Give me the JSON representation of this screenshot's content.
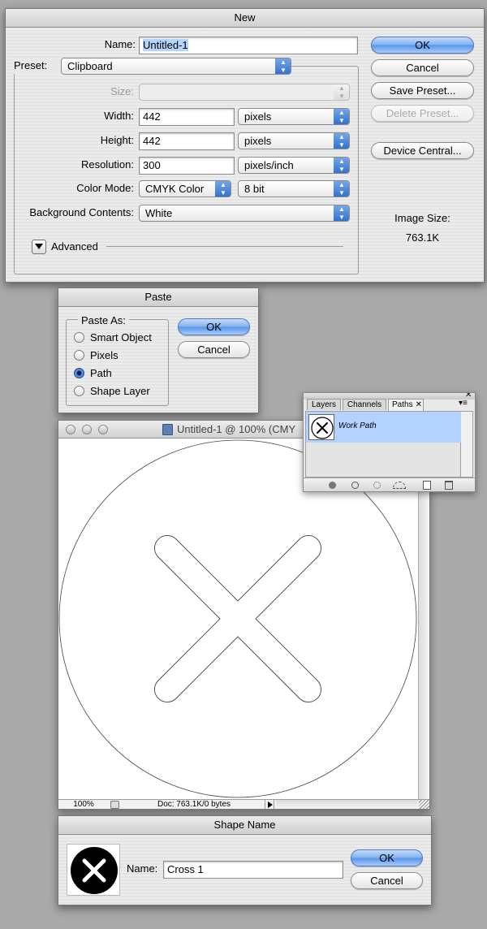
{
  "new_dialog": {
    "title": "New",
    "name_label": "Name:",
    "name_value": "Untitled-1",
    "preset_label": "Preset:",
    "preset_value": "Clipboard",
    "size_label": "Size:",
    "width_label": "Width:",
    "width_value": "442",
    "width_unit": "pixels",
    "height_label": "Height:",
    "height_value": "442",
    "height_unit": "pixels",
    "resolution_label": "Resolution:",
    "resolution_value": "300",
    "resolution_unit": "pixels/inch",
    "color_mode_label": "Color Mode:",
    "color_mode_value": "CMYK Color",
    "bit_depth_value": "8 bit",
    "background_label": "Background Contents:",
    "background_value": "White",
    "advanced_label": "Advanced",
    "buttons": {
      "ok": "OK",
      "cancel": "Cancel",
      "save_preset": "Save Preset...",
      "delete_preset": "Delete Preset...",
      "device_central": "Device Central..."
    },
    "image_size_label": "Image Size:",
    "image_size_value": "763.1K"
  },
  "paste_dialog": {
    "title": "Paste",
    "group_label": "Paste As:",
    "options": [
      "Smart Object",
      "Pixels",
      "Path",
      "Shape Layer"
    ],
    "selected": "Path",
    "ok": "OK",
    "cancel": "Cancel"
  },
  "document_window": {
    "title": "Untitled-1 @ 100% (CMY",
    "zoom": "100%",
    "doc_info": "Doc: 763.1K/0 bytes"
  },
  "paths_panel": {
    "tabs": [
      "Layers",
      "Channels",
      "Paths"
    ],
    "active_tab": "Paths",
    "path_name": "Work Path"
  },
  "shape_name_dialog": {
    "title": "Shape Name",
    "name_label": "Name:",
    "name_value": "Cross 1",
    "ok": "OK",
    "cancel": "Cancel"
  },
  "colors": {
    "selection_highlight": "#b5d5ff",
    "default_button": "#5794ea",
    "panel_selected_row": "#b4d2ff"
  }
}
